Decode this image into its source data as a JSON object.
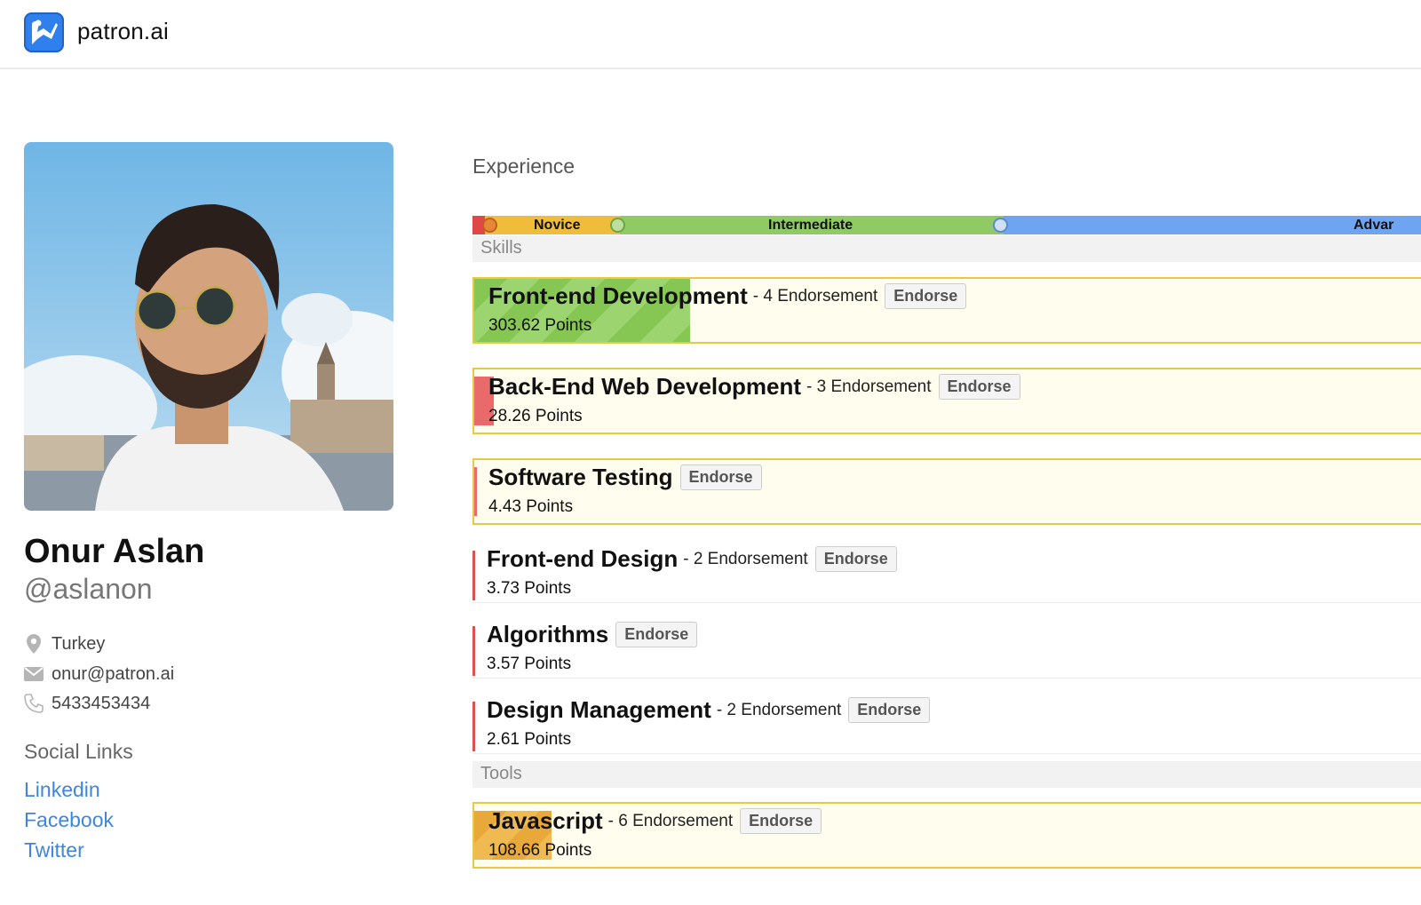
{
  "header": {
    "brand": "patron.ai",
    "logo_icon": "patron-logo-icon",
    "accent": "#2f80ed"
  },
  "profile": {
    "name": "Onur Aslan",
    "handle": "@aslanon",
    "location": "Turkey",
    "email": "onur@patron.ai",
    "phone": "5433453434",
    "icons": {
      "location": "map-pin-icon",
      "email": "envelope-icon",
      "phone": "phone-icon"
    }
  },
  "social": {
    "title": "Social Links",
    "links": [
      "Linkedin",
      "Facebook",
      "Twitter"
    ],
    "color": "#3d86e0"
  },
  "experience": {
    "title": "Experience",
    "levels": [
      {
        "label": "Novice",
        "color": "#efbd3b"
      },
      {
        "label": "Intermediate",
        "color": "#8fca62"
      },
      {
        "label": "Advar",
        "color": "#6ea4f0"
      }
    ],
    "sections": {
      "skills": "Skills",
      "tools": "Tools"
    },
    "endorse_label": "Endorse",
    "skills": [
      {
        "name": "Front-end Development",
        "endorsements": "- 4 Endorsement",
        "points": "303.62 Points",
        "level_fraction": 0.229,
        "fill": "green"
      },
      {
        "name": "Back-End Web Development",
        "endorsements": "- 3 Endorsement",
        "points": "28.26 Points",
        "level_fraction": 0.021,
        "fill": "red"
      },
      {
        "name": "Software Testing",
        "endorsements": "",
        "points": "4.43 Points",
        "level_fraction": 0.004,
        "fill": "red"
      },
      {
        "name": "Front-end Design",
        "endorsements": "- 2 Endorsement",
        "points": "3.73 Points",
        "level_fraction": 0.003,
        "fill": "red"
      },
      {
        "name": "Algorithms",
        "endorsements": "",
        "points": "3.57 Points",
        "level_fraction": 0.003,
        "fill": "red"
      },
      {
        "name": "Design Management",
        "endorsements": "- 2 Endorsement",
        "points": "2.61 Points",
        "level_fraction": 0.002,
        "fill": "red"
      }
    ],
    "tools": [
      {
        "name": "Javascript",
        "endorsements": "- 6 Endorsement",
        "points": "108.66 Points",
        "level_fraction": 0.082,
        "fill": "orange"
      }
    ]
  }
}
